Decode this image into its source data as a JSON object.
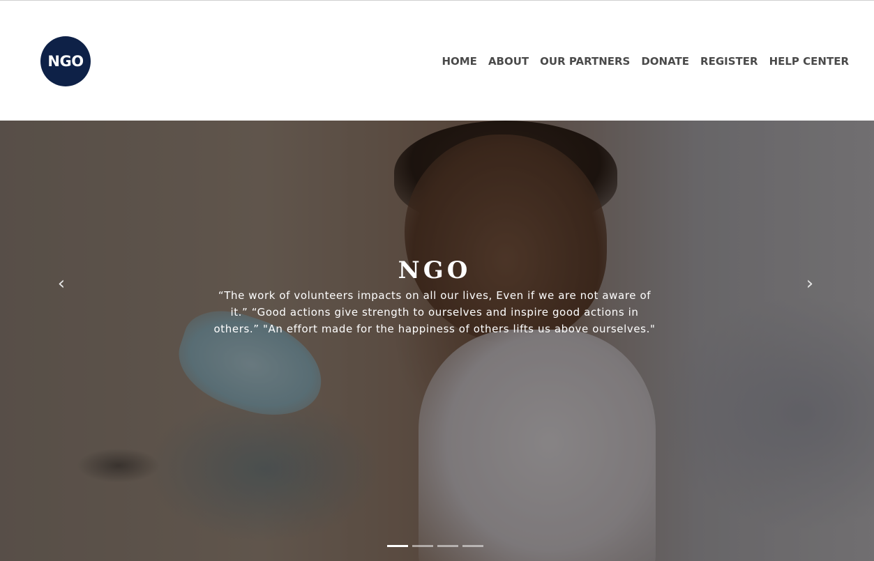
{
  "header": {
    "logo_text": "NGO",
    "nav": [
      {
        "label": "HOME"
      },
      {
        "label": "ABOUT"
      },
      {
        "label": "OUR PARTNERS"
      },
      {
        "label": "DONATE"
      },
      {
        "label": "REGISTER"
      },
      {
        "label": "HELP CENTER"
      }
    ]
  },
  "carousel": {
    "title": "NGO",
    "text": "“The work of volunteers impacts on all our lives, Even if we are not aware of it.” “Good actions give strength to ourselves and inspire good actions in others.” \"An effort made for the happiness of others lifts us above ourselves.\"",
    "prev_icon": "‹",
    "next_icon": "›",
    "indicator_count": 4,
    "active_index": 0
  },
  "colors": {
    "logo_bg": "#0e2147",
    "nav_text": "#4a4a4a"
  }
}
